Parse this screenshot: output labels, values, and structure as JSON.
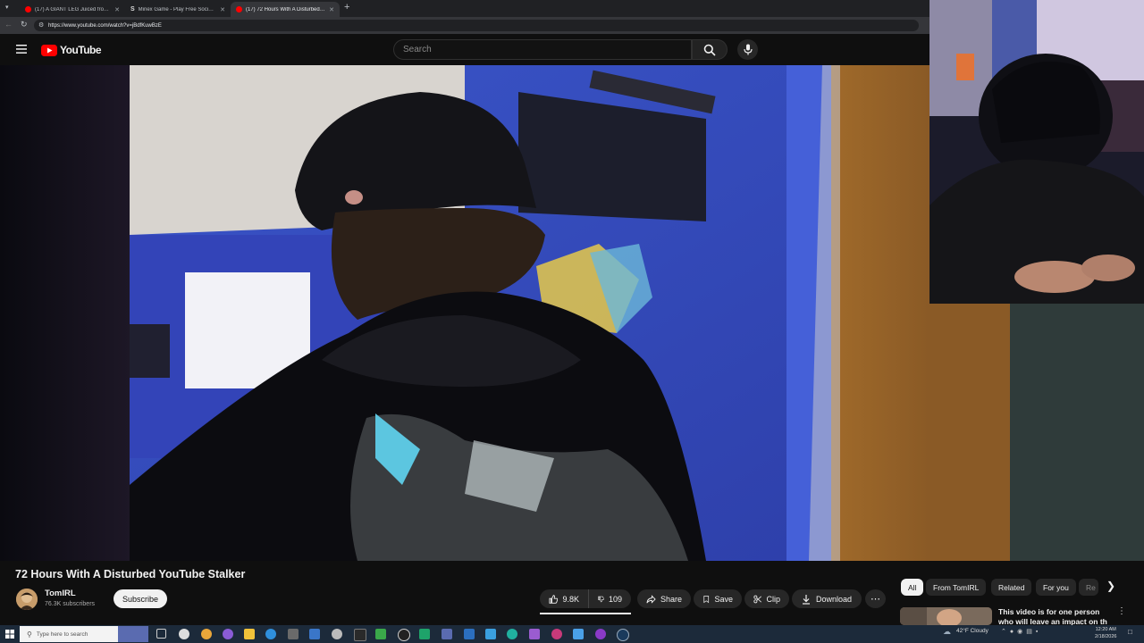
{
  "browser": {
    "tabs": [
      {
        "title": "(17) A GIANT LEG Juiced from the",
        "favicon": "youtube-icon",
        "active": false
      },
      {
        "title": "Minex Game - Play Free Social Ca",
        "favicon": "s-icon",
        "active": false
      },
      {
        "title": "(17) 72 Hours With A Disturbed Yo",
        "favicon": "youtube-icon",
        "active": true
      }
    ],
    "new_tab": "+",
    "url": "https://www.youtube.com/watch?v=jBdfKuwBzE"
  },
  "youtube": {
    "logo_text": "YouTube",
    "search_placeholder": "Search"
  },
  "video": {
    "title": "72 Hours With A Disturbed YouTube Stalker",
    "channel_name": "TomIRL",
    "subscriber_count": "76.3K subscribers",
    "subscribe_label": "Subscribe",
    "likes": "9.8K",
    "dislikes": "109",
    "share_label": "Share",
    "save_label": "Save",
    "clip_label": "Clip",
    "download_label": "Download",
    "more_label": "⋯"
  },
  "recommendations": {
    "chips": [
      "All",
      "From TomIRL",
      "Related",
      "For you",
      "Re"
    ],
    "first_title": "This video is for one person who will leave an impact on th"
  },
  "taskbar": {
    "search_placeholder": "Type here to search",
    "weather": "42°F  Cloudy",
    "time": "12:20 AM",
    "date": "2/18/2026"
  },
  "colors": {
    "youtube_red": "#ff0000",
    "background": "#0f0f0f",
    "pill": "#272727"
  }
}
